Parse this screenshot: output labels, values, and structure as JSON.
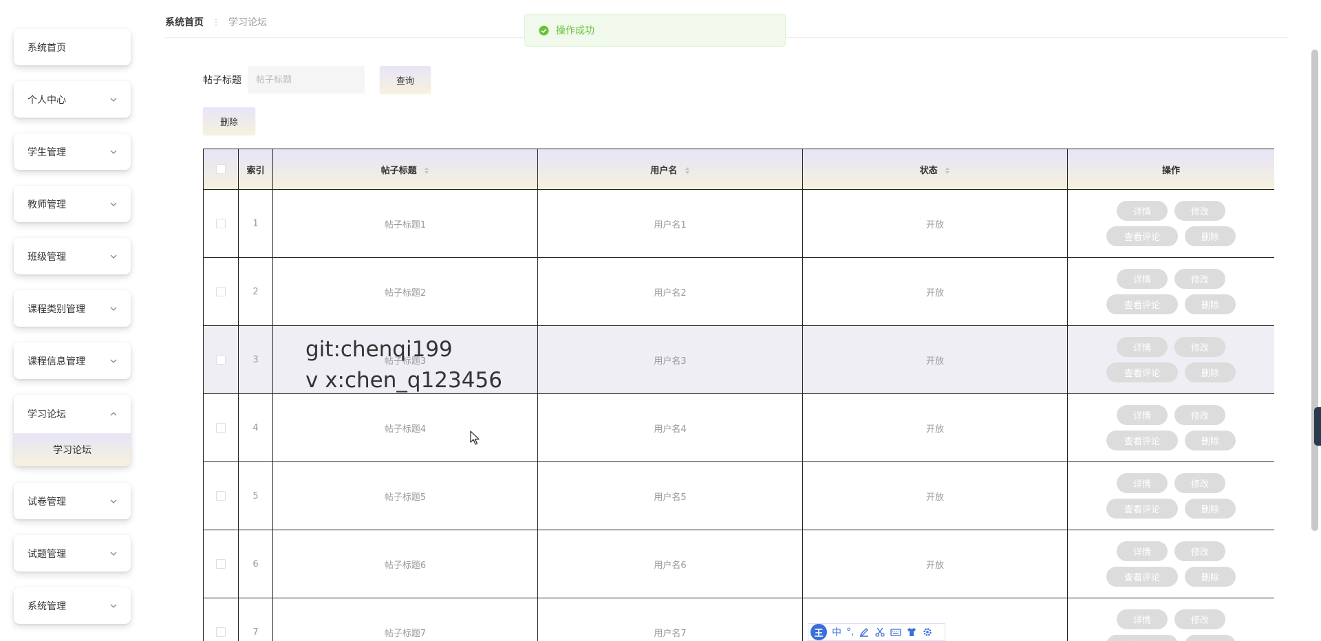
{
  "sidebar": {
    "items": [
      {
        "label": "系统首页",
        "expandable": false
      },
      {
        "label": "个人中心",
        "expandable": true
      },
      {
        "label": "学生管理",
        "expandable": true
      },
      {
        "label": "教师管理",
        "expandable": true
      },
      {
        "label": "班级管理",
        "expandable": true
      },
      {
        "label": "课程类别管理",
        "expandable": true
      },
      {
        "label": "课程信息管理",
        "expandable": true
      },
      {
        "label": "学习论坛",
        "expandable": true,
        "expanded": true,
        "children": [
          {
            "label": "学习论坛",
            "active": true
          }
        ]
      },
      {
        "label": "试卷管理",
        "expandable": true
      },
      {
        "label": "试题管理",
        "expandable": true
      },
      {
        "label": "系统管理",
        "expandable": true
      }
    ]
  },
  "breadcrumb": {
    "home": "系统首页",
    "separator": "⋮",
    "current": "学习论坛"
  },
  "toast": {
    "message": "操作成功",
    "color": "#67c23a"
  },
  "search": {
    "label": "帖子标题",
    "placeholder": "帖子标题",
    "value": "",
    "query_label": "查询"
  },
  "toolbar": {
    "delete_label": "删除"
  },
  "table": {
    "columns": [
      "",
      "索引",
      "帖子标题",
      "用户名",
      "状态",
      "操作"
    ],
    "actions": {
      "detail": "详情",
      "edit": "修改",
      "comments": "查看评论",
      "delete": "删除"
    },
    "rows": [
      {
        "index": "1",
        "title": "帖子标题1",
        "username": "用户名1",
        "status": "开放"
      },
      {
        "index": "2",
        "title": "帖子标题2",
        "username": "用户名2",
        "status": "开放"
      },
      {
        "index": "3",
        "title": "帖子标题3",
        "username": "用户名3",
        "status": "开放"
      },
      {
        "index": "4",
        "title": "帖子标题4",
        "username": "用户名4",
        "status": "开放"
      },
      {
        "index": "5",
        "title": "帖子标题5",
        "username": "用户名5",
        "status": "开放"
      },
      {
        "index": "6",
        "title": "帖子标题6",
        "username": "用户名6",
        "status": "开放"
      },
      {
        "index": "7",
        "title": "帖子标题7",
        "username": "用户名7",
        "status": "开放"
      }
    ]
  },
  "watermark": {
    "line1": "git:chenqi199",
    "line2": "v x:chen_q123456"
  },
  "ime": {
    "logo": "王",
    "mode": "中",
    "punct": "°,"
  },
  "colors": {
    "header_gradient_top": "#e6e4f8",
    "header_gradient_bottom": "#f7f1dc",
    "action_button": "#dcdcdc"
  }
}
